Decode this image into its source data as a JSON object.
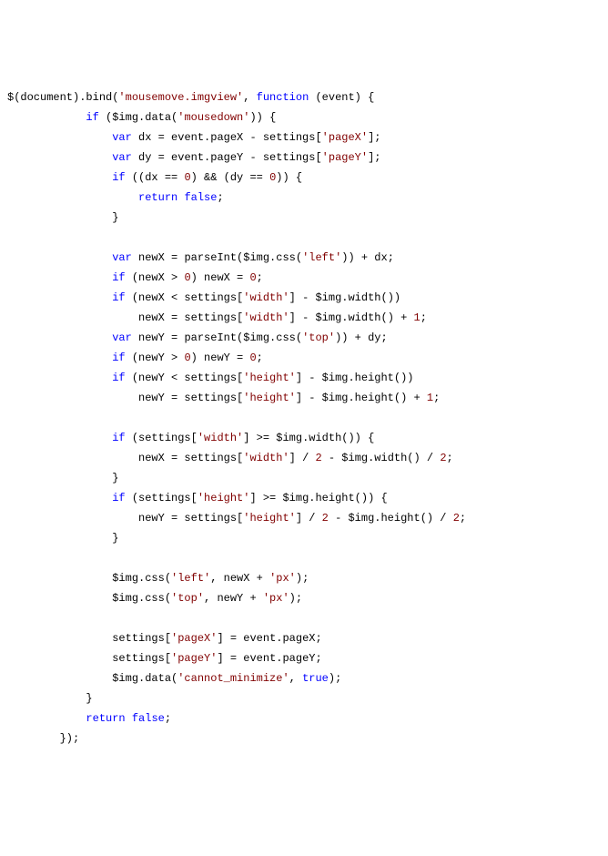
{
  "lines": [
    [
      {
        "t": "$(document).bind("
      },
      {
        "t": "'mousemove.imgview'",
        "c": "str"
      },
      {
        "t": ", "
      },
      {
        "t": "function",
        "c": "kw"
      },
      {
        "t": " (event) {"
      }
    ],
    [
      {
        "t": "            "
      },
      {
        "t": "if",
        "c": "kw"
      },
      {
        "t": " ($img.data("
      },
      {
        "t": "'mousedown'",
        "c": "str"
      },
      {
        "t": ")) {"
      }
    ],
    [
      {
        "t": "                "
      },
      {
        "t": "var",
        "c": "kw"
      },
      {
        "t": " dx = event.pageX - settings["
      },
      {
        "t": "'pageX'",
        "c": "str"
      },
      {
        "t": "];"
      }
    ],
    [
      {
        "t": "                "
      },
      {
        "t": "var",
        "c": "kw"
      },
      {
        "t": " dy = event.pageY - settings["
      },
      {
        "t": "'pageY'",
        "c": "str"
      },
      {
        "t": "];"
      }
    ],
    [
      {
        "t": "                "
      },
      {
        "t": "if",
        "c": "kw"
      },
      {
        "t": " ((dx == "
      },
      {
        "t": "0",
        "c": "num"
      },
      {
        "t": ") && (dy == "
      },
      {
        "t": "0",
        "c": "num"
      },
      {
        "t": ")) {"
      }
    ],
    [
      {
        "t": "                    "
      },
      {
        "t": "return",
        "c": "kw"
      },
      {
        "t": " "
      },
      {
        "t": "false",
        "c": "kw"
      },
      {
        "t": ";"
      }
    ],
    [
      {
        "t": "                }"
      }
    ],
    [
      {
        "t": ""
      }
    ],
    [
      {
        "t": "                "
      },
      {
        "t": "var",
        "c": "kw"
      },
      {
        "t": " newX = parseInt($img.css("
      },
      {
        "t": "'left'",
        "c": "str"
      },
      {
        "t": ")) + dx;"
      }
    ],
    [
      {
        "t": "                "
      },
      {
        "t": "if",
        "c": "kw"
      },
      {
        "t": " (newX > "
      },
      {
        "t": "0",
        "c": "num"
      },
      {
        "t": ") newX = "
      },
      {
        "t": "0",
        "c": "num"
      },
      {
        "t": ";"
      }
    ],
    [
      {
        "t": "                "
      },
      {
        "t": "if",
        "c": "kw"
      },
      {
        "t": " (newX < settings["
      },
      {
        "t": "'width'",
        "c": "str"
      },
      {
        "t": "] - $img.width())"
      }
    ],
    [
      {
        "t": "                    newX = settings["
      },
      {
        "t": "'width'",
        "c": "str"
      },
      {
        "t": "] - $img.width() + "
      },
      {
        "t": "1",
        "c": "num"
      },
      {
        "t": ";"
      }
    ],
    [
      {
        "t": "                "
      },
      {
        "t": "var",
        "c": "kw"
      },
      {
        "t": " newY = parseInt($img.css("
      },
      {
        "t": "'top'",
        "c": "str"
      },
      {
        "t": ")) + dy;"
      }
    ],
    [
      {
        "t": "                "
      },
      {
        "t": "if",
        "c": "kw"
      },
      {
        "t": " (newY > "
      },
      {
        "t": "0",
        "c": "num"
      },
      {
        "t": ") newY = "
      },
      {
        "t": "0",
        "c": "num"
      },
      {
        "t": ";"
      }
    ],
    [
      {
        "t": "                "
      },
      {
        "t": "if",
        "c": "kw"
      },
      {
        "t": " (newY < settings["
      },
      {
        "t": "'height'",
        "c": "str"
      },
      {
        "t": "] - $img.height())"
      }
    ],
    [
      {
        "t": "                    newY = settings["
      },
      {
        "t": "'height'",
        "c": "str"
      },
      {
        "t": "] - $img.height() + "
      },
      {
        "t": "1",
        "c": "num"
      },
      {
        "t": ";"
      }
    ],
    [
      {
        "t": ""
      }
    ],
    [
      {
        "t": "                "
      },
      {
        "t": "if",
        "c": "kw"
      },
      {
        "t": " (settings["
      },
      {
        "t": "'width'",
        "c": "str"
      },
      {
        "t": "] >= $img.width()) {"
      }
    ],
    [
      {
        "t": "                    newX = settings["
      },
      {
        "t": "'width'",
        "c": "str"
      },
      {
        "t": "] / "
      },
      {
        "t": "2",
        "c": "num"
      },
      {
        "t": " - $img.width() / "
      },
      {
        "t": "2",
        "c": "num"
      },
      {
        "t": ";"
      }
    ],
    [
      {
        "t": "                }"
      }
    ],
    [
      {
        "t": "                "
      },
      {
        "t": "if",
        "c": "kw"
      },
      {
        "t": " (settings["
      },
      {
        "t": "'height'",
        "c": "str"
      },
      {
        "t": "] >= $img.height()) {"
      }
    ],
    [
      {
        "t": "                    newY = settings["
      },
      {
        "t": "'height'",
        "c": "str"
      },
      {
        "t": "] / "
      },
      {
        "t": "2",
        "c": "num"
      },
      {
        "t": " - $img.height() / "
      },
      {
        "t": "2",
        "c": "num"
      },
      {
        "t": ";"
      }
    ],
    [
      {
        "t": "                }"
      }
    ],
    [
      {
        "t": ""
      }
    ],
    [
      {
        "t": "                $img.css("
      },
      {
        "t": "'left'",
        "c": "str"
      },
      {
        "t": ", newX + "
      },
      {
        "t": "'px'",
        "c": "str"
      },
      {
        "t": ");"
      }
    ],
    [
      {
        "t": "                $img.css("
      },
      {
        "t": "'top'",
        "c": "str"
      },
      {
        "t": ", newY + "
      },
      {
        "t": "'px'",
        "c": "str"
      },
      {
        "t": ");"
      }
    ],
    [
      {
        "t": ""
      }
    ],
    [
      {
        "t": "                settings["
      },
      {
        "t": "'pageX'",
        "c": "str"
      },
      {
        "t": "] = event.pageX;"
      }
    ],
    [
      {
        "t": "                settings["
      },
      {
        "t": "'pageY'",
        "c": "str"
      },
      {
        "t": "] = event.pageY;"
      }
    ],
    [
      {
        "t": "                $img.data("
      },
      {
        "t": "'cannot_minimize'",
        "c": "str"
      },
      {
        "t": ", "
      },
      {
        "t": "true",
        "c": "kw"
      },
      {
        "t": ");"
      }
    ],
    [
      {
        "t": "            }"
      }
    ],
    [
      {
        "t": "            "
      },
      {
        "t": "return",
        "c": "kw"
      },
      {
        "t": " "
      },
      {
        "t": "false",
        "c": "kw"
      },
      {
        "t": ";"
      }
    ],
    [
      {
        "t": "        });"
      }
    ]
  ]
}
